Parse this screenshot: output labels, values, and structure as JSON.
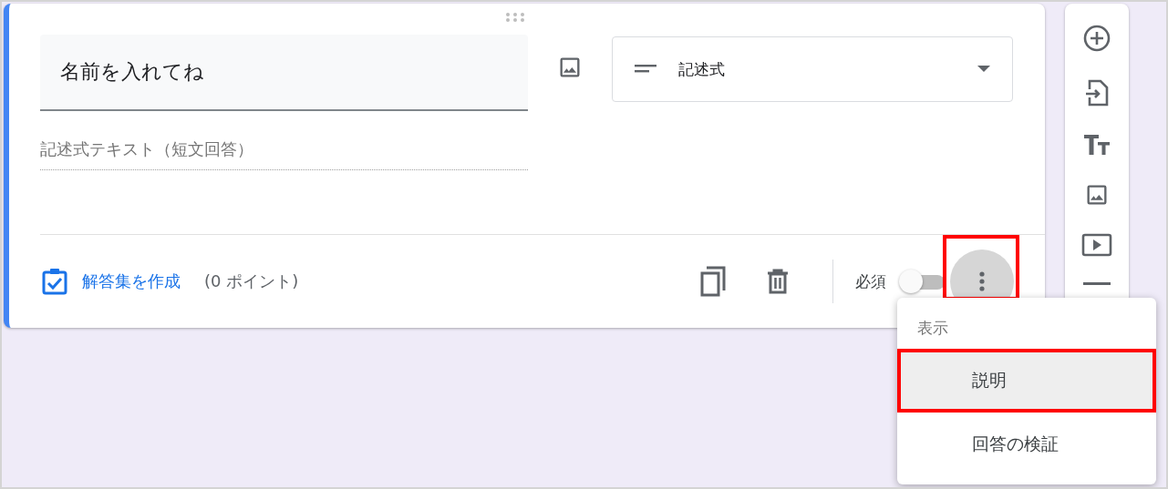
{
  "question": {
    "title": "名前を入れてね"
  },
  "type_dropdown": {
    "value": "記述式"
  },
  "answer": {
    "placeholder": "記述式テキスト（短文回答）"
  },
  "footer": {
    "answer_key": "解答集を作成",
    "points": "(0 ポイント)",
    "required_label": "必須",
    "required": false,
    "more_highlighted": true
  },
  "menu": {
    "header": "表示",
    "items": [
      {
        "label": "説明",
        "selected": true,
        "highlighted": true
      },
      {
        "label": "回答の検証",
        "selected": false,
        "highlighted": false
      }
    ]
  }
}
